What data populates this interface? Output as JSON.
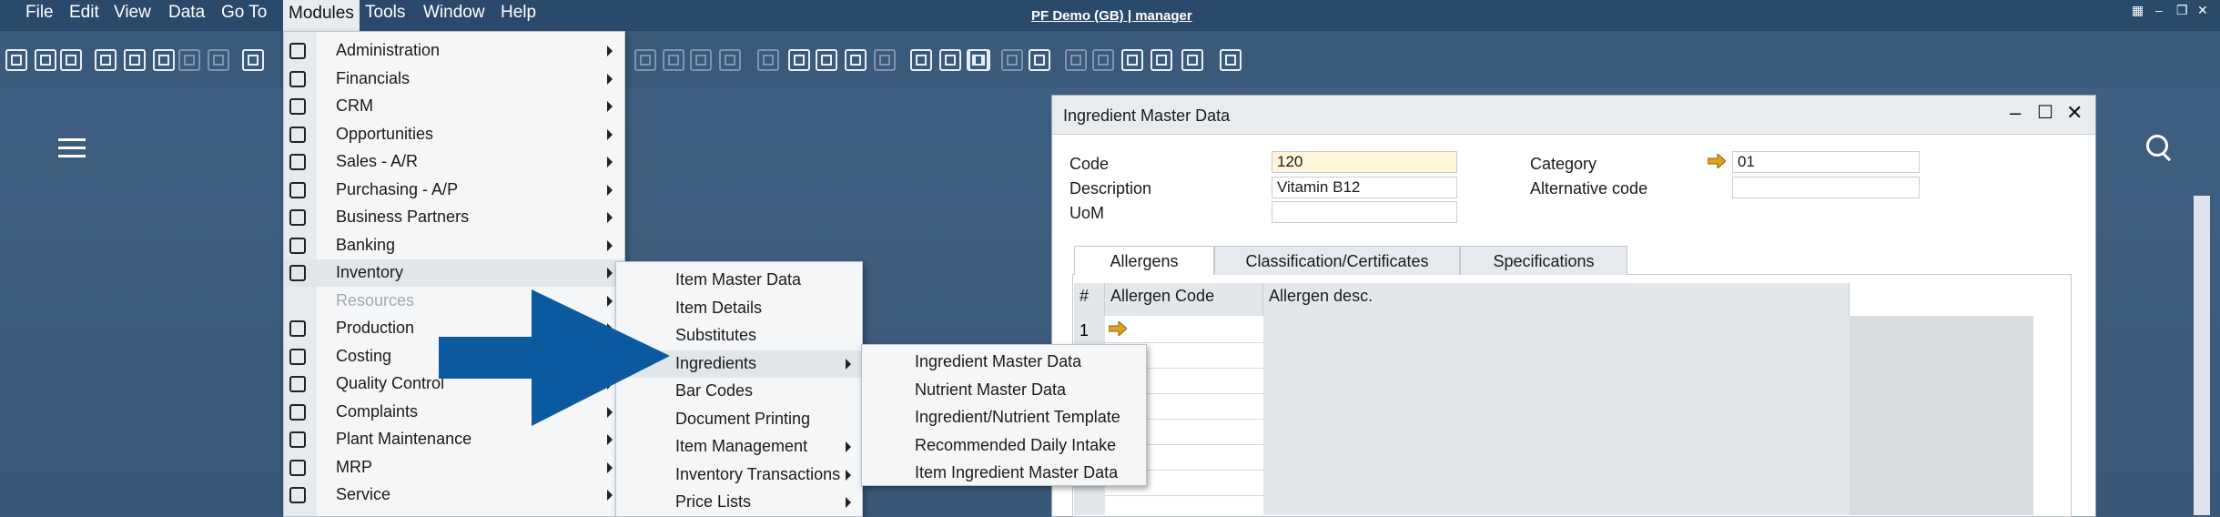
{
  "menubar": {
    "items": [
      "File",
      "Edit",
      "View",
      "Data",
      "Go To",
      "Modules",
      "Tools",
      "Window",
      "Help"
    ],
    "title": "PF Demo (GB) | manager"
  },
  "modules_menu": {
    "items": [
      {
        "label": "Administration",
        "icon": "gear-icon",
        "disabled": false
      },
      {
        "label": "Financials",
        "icon": "ledger-icon",
        "disabled": false
      },
      {
        "label": "CRM",
        "icon": "people-icon",
        "disabled": false
      },
      {
        "label": "Opportunities",
        "icon": "chart-icon",
        "disabled": false
      },
      {
        "label": "Sales - A/R",
        "icon": "dollar-icon",
        "disabled": false
      },
      {
        "label": "Purchasing - A/P",
        "icon": "cart-icon",
        "disabled": false
      },
      {
        "label": "Business Partners",
        "icon": "contact-card-icon",
        "disabled": false
      },
      {
        "label": "Banking",
        "icon": "money-bag-icon",
        "disabled": false
      },
      {
        "label": "Inventory",
        "icon": "boxes-icon",
        "disabled": false
      },
      {
        "label": "Resources",
        "icon": "",
        "disabled": true
      },
      {
        "label": "Production",
        "icon": "cube-icon",
        "disabled": false
      },
      {
        "label": "Costing",
        "icon": "leaf-icon",
        "disabled": false
      },
      {
        "label": "Quality Control",
        "icon": "pin-icon",
        "disabled": false
      },
      {
        "label": "Complaints",
        "icon": "clipboard-icon",
        "disabled": false
      },
      {
        "label": "Plant Maintenance",
        "icon": "tools-icon",
        "disabled": false
      },
      {
        "label": "MRP",
        "icon": "calendar-icon",
        "disabled": false
      },
      {
        "label": "Service",
        "icon": "building-icon",
        "disabled": false
      }
    ]
  },
  "inventory_menu": {
    "items": [
      "Item Master Data",
      "Item Details",
      "Substitutes",
      "Ingredients",
      "Bar Codes",
      "Document Printing",
      "Item Management",
      "Inventory Transactions",
      "Price Lists"
    ]
  },
  "ingredients_menu": {
    "items": [
      "Ingredient Master Data",
      "Nutrient Master Data",
      "Ingredient/Nutrient Template",
      "Recommended Daily Intake",
      "Item Ingredient Master Data"
    ]
  },
  "ingredient_window": {
    "title": "Ingredient Master Data",
    "fields": {
      "code_label": "Code",
      "code_value": "120",
      "description_label": "Description",
      "description_value": "Vitamin B12",
      "uom_label": "UoM",
      "uom_value": "",
      "category_label": "Category",
      "category_value": "01",
      "alt_code_label": "Alternative code",
      "alt_code_value": ""
    },
    "tabs": [
      "Allergens",
      "Classification/Certificates",
      "Specifications"
    ],
    "grid": {
      "columns": [
        "#",
        "Allergen Code",
        "Allergen desc."
      ],
      "rows": [
        {
          "num": "1",
          "code": "",
          "desc": ""
        }
      ]
    }
  },
  "colors": {
    "app_bg": "#3c5a7c",
    "menubar_bg": "#2a4a6c",
    "accent_arrow": "#0b5aa0",
    "active_field": "#fff6da",
    "link_arrow": "#e0a020"
  }
}
